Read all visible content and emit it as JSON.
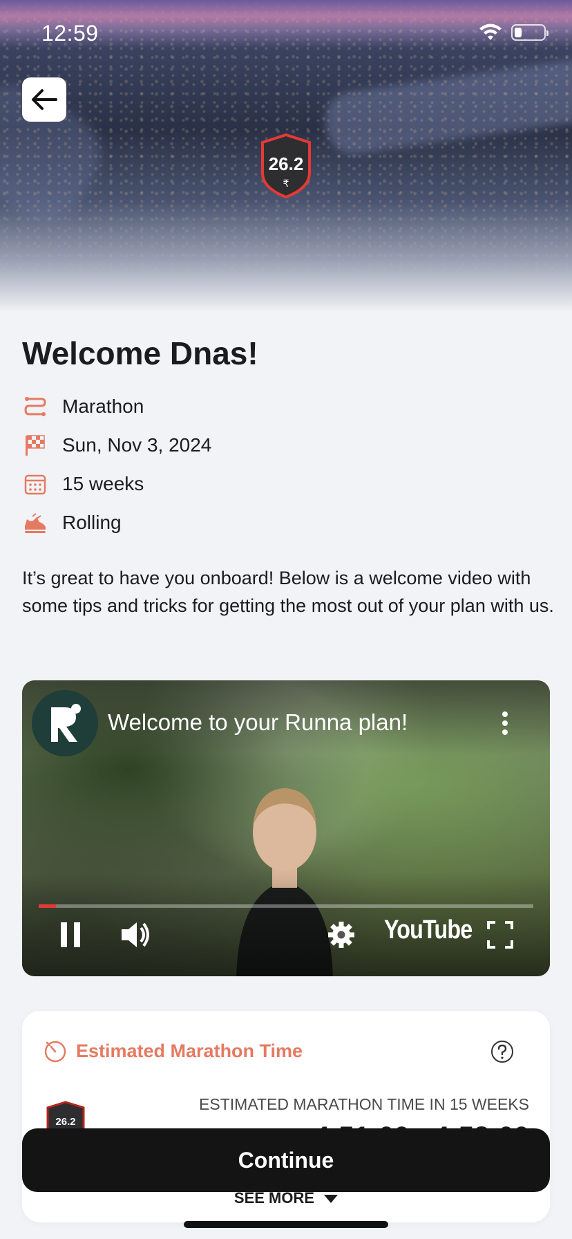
{
  "status_bar": {
    "time": "12:59"
  },
  "hero": {
    "badge_distance": "26.2"
  },
  "welcome": {
    "title": "Welcome Dnas!"
  },
  "plan_info": [
    {
      "icon": "route-icon",
      "label": "Marathon"
    },
    {
      "icon": "finish-flag-icon",
      "label": "Sun, Nov 3, 2024"
    },
    {
      "icon": "calendar-icon",
      "label": "15 weeks"
    },
    {
      "icon": "running-shoe-icon",
      "label": "Rolling"
    }
  ],
  "intro_text": "It’s great to have you onboard! Below is a welcome video with some tips and tricks for getting the most out of your plan with us.",
  "video": {
    "title": "Welcome to your Runna plan!",
    "platform": "YouTube",
    "progress_fraction": 0.035
  },
  "estimate_card": {
    "title": "Estimated Marathon Time",
    "label": "ESTIMATED MARATHON TIME IN 15 WEEKS",
    "time_range": "4:51:00 - 4:58:00",
    "badge_distance": "26.2",
    "see_more": "SEE MORE"
  },
  "continue_button": {
    "label": "Continue"
  },
  "colors": {
    "accent": "#e57a62",
    "button": "#141414",
    "badge_border": "#e53935",
    "background": "#f2f3f6"
  }
}
